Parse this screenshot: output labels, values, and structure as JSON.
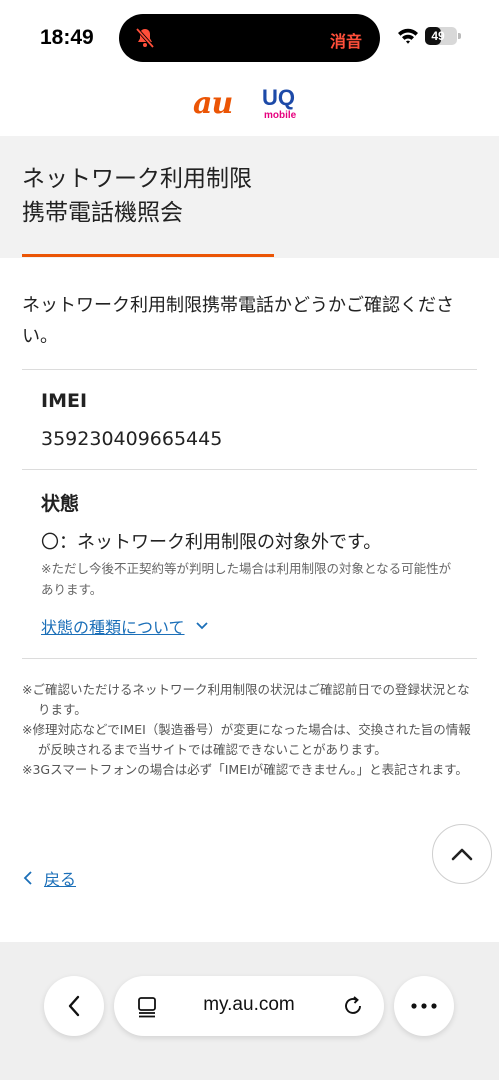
{
  "status_bar": {
    "time": "18:49",
    "mute_label": "消音",
    "battery_level": "49",
    "battery_percent": 49
  },
  "header": {
    "au_logo_text": "au",
    "uq_logo_text": "UQ",
    "uq_logo_sub": "mobile",
    "brand_colors": {
      "au": "#eb5505",
      "uq": "#1d4aa8",
      "uq_sub": "#e6007e"
    }
  },
  "page": {
    "title": "ネットワーク利用制限\n携帯電話機照会",
    "intro": "ネットワーク利用制限携帯電話かどうかご確認ください。",
    "imei_label": "IMEI",
    "imei_value": "359230409665445",
    "status_label": "状態",
    "status_text": "〇：ネットワーク利用制限の対象外です。",
    "status_note": "※ただし今後不正契約等が判明した場合は利用制限の対象となる可能性があります。",
    "status_link": "状態の種類について",
    "notes": [
      "※ご確認いただけるネットワーク利用制限の状況はご確認前日での登録状況となります。",
      "※修理対応などでIMEI（製造番号）が変更になった場合は、交換された旨の情報が反映されるまで当サイトでは確認できないことがあります。",
      "※3Gスマートフォンの場合は必ず「IMEIが確認できません。」と表記されます。"
    ],
    "back_link": "戻る"
  },
  "browser": {
    "url": "my.au.com"
  },
  "icons": {
    "mute": "bell-slash-icon",
    "wifi": "wifi-icon",
    "scroll_top": "chevron-up-icon",
    "back": "chevron-left-icon",
    "tabs": "tabs-icon",
    "reload": "reload-icon",
    "more": "more-dots-icon"
  },
  "colors": {
    "accent": "#eb5505",
    "link": "#1b6fb8",
    "title_band": "#f2f2f2",
    "mute_text": "#ff4f3a"
  }
}
